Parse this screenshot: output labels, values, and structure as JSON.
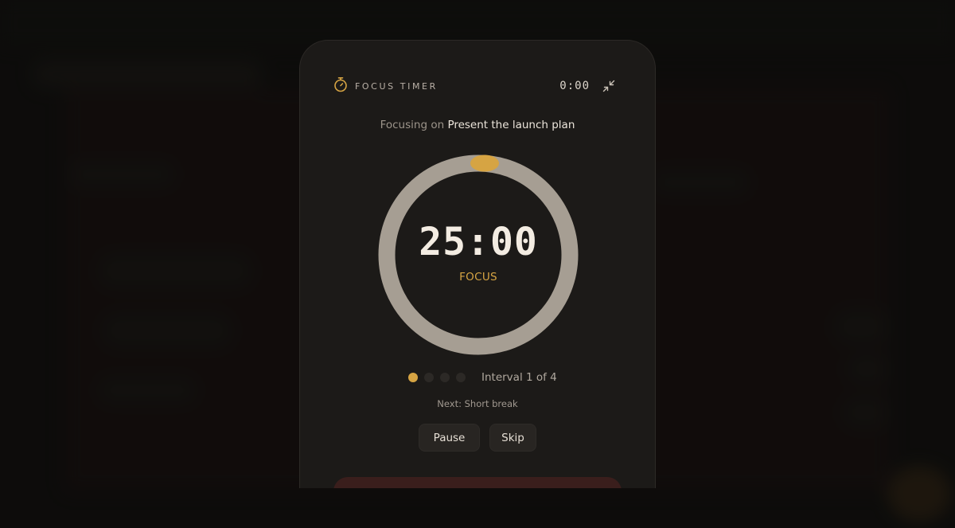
{
  "timer": {
    "title": "FOCUS TIMER",
    "mini_time": "0:00",
    "focusing_prefix": "Focusing on ",
    "task": "Present the launch plan",
    "time": "25:00",
    "mode": "FOCUS",
    "interval": {
      "label": "Interval 1 of 4",
      "current": 1,
      "total": 4
    },
    "progress": 0.0,
    "next": "Next: Short break",
    "buttons": {
      "pause": "Pause",
      "skip": "Skip"
    }
  },
  "icons": {
    "header": "stopwatch-icon",
    "collapse": "collapse-icon"
  },
  "colors": {
    "accent": "#d6a443",
    "ring_track": "#a69e93",
    "modal_bg": "#1c1a18",
    "page_bg": "#121110"
  }
}
